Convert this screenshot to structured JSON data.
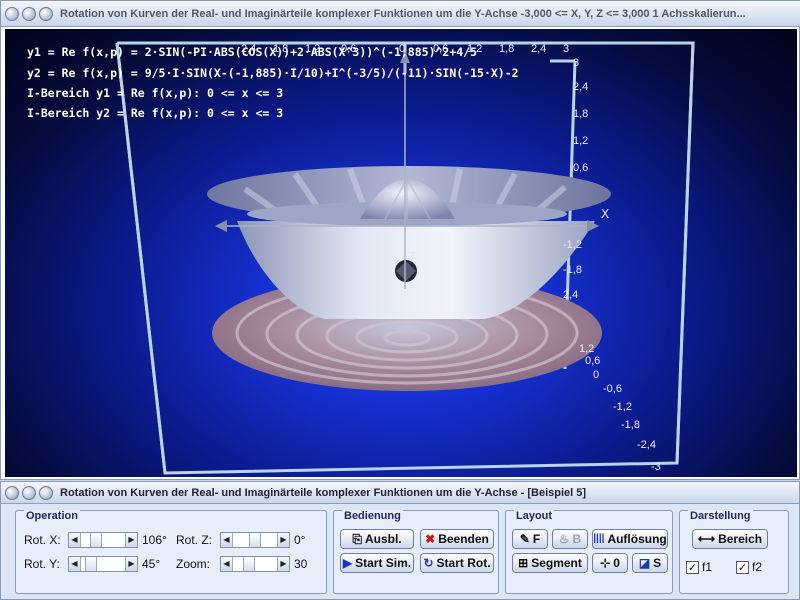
{
  "viewer": {
    "title": "Rotation von Kurven der Real- und Imaginärteile komplexer Funktionen um die Y-Achse    -3,000 <= X, Y, Z <= 3,000    1 Achsskalierun...",
    "formulas": [
      "y1 = Re f(x,p) = 2·SIN(-PI·ABS(COS(X))+2·ABS(X^3))^(-1,885)^2+4/5",
      "y2 = Re f(x,p) = 9/5·I·SIN(X-(-1,885)·I/10)+I^(-3/5)/(-11)·SIN(-15·X)-2",
      "I-Bereich y1 = Re f(x,p): 0 <= x <= 3",
      "I-Bereich y2 = Re f(x,p): 0 <= x <= 3"
    ],
    "axis": {
      "x_label": "X",
      "z_label": "Z",
      "top_ticks": [
        "2,4",
        "1,8",
        "1,2",
        "0,6",
        "0",
        "0,6",
        "1,2",
        "1,8",
        "2,4",
        "3"
      ],
      "right_ticks": [
        "3",
        "2,4",
        "1,8",
        "1,2",
        "0,6"
      ],
      "mid_ticks": [
        "-1,2",
        "-1,8",
        "2,4"
      ],
      "lower_ticks": [
        "1,2",
        "0,6",
        "0",
        "-0,6",
        "-1,2",
        "-1,8",
        "-2,4",
        "-3"
      ]
    },
    "colors": {
      "bg_center": "#2a4cff",
      "bg_edge": "#02041a",
      "box": "#b8d4e8",
      "surface": "#cdd3e8",
      "disk": "#b08a98"
    }
  },
  "panel": {
    "title": "Rotation von Kurven der Real- und Imaginärteile komplexer Funktionen um die Y-Achse - [Beispiel 5]",
    "operation": {
      "title": "Operation",
      "rot_x_label": "Rot. X:",
      "rot_x_value": "106°",
      "rot_y_label": "Rot. Y:",
      "rot_y_value": "45°",
      "rot_z_label": "Rot. Z:",
      "rot_z_value": "0°",
      "zoom_label": "Zoom:",
      "zoom_value": "30",
      "rot_x_level": 0.29,
      "rot_y_level": 0.13,
      "rot_z_level": 0.5,
      "zoom_level": 0.3
    },
    "bedienung": {
      "title": "Bedienung",
      "ausbl": "Ausbl.",
      "beenden": "Beenden",
      "start_sim": "Start Sim.",
      "start_rot": "Start Rot."
    },
    "layout": {
      "title": "Layout",
      "f_btn": "F",
      "b_btn": "B",
      "aufloesung": "Auflösung",
      "segment": "Segment",
      "zero_btn": "0",
      "s_btn": "S"
    },
    "darstellung": {
      "title": "Darstellung",
      "bereich": "Bereich",
      "f1": "f1",
      "f2": "f2",
      "f1_checked": "✓",
      "f2_checked": "✓"
    }
  }
}
